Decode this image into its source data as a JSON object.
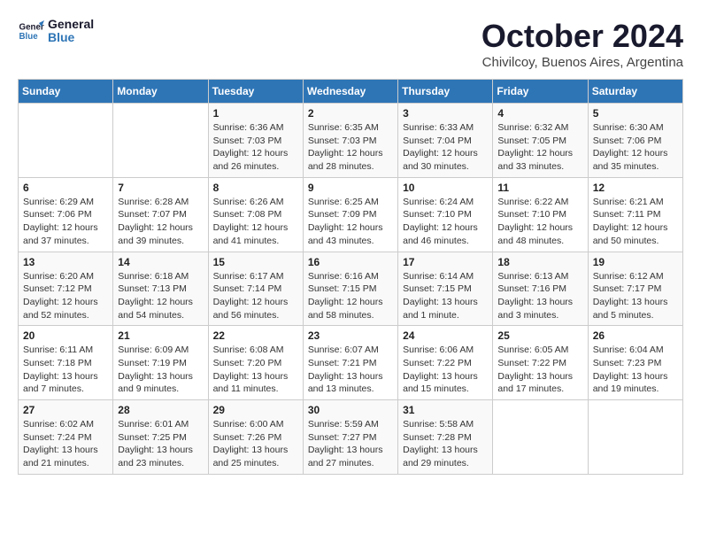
{
  "header": {
    "logo_line1": "General",
    "logo_line2": "Blue",
    "month": "October 2024",
    "location": "Chivilcoy, Buenos Aires, Argentina"
  },
  "weekdays": [
    "Sunday",
    "Monday",
    "Tuesday",
    "Wednesday",
    "Thursday",
    "Friday",
    "Saturday"
  ],
  "weeks": [
    [
      {
        "day": "",
        "info": ""
      },
      {
        "day": "",
        "info": ""
      },
      {
        "day": "1",
        "info": "Sunrise: 6:36 AM\nSunset: 7:03 PM\nDaylight: 12 hours\nand 26 minutes."
      },
      {
        "day": "2",
        "info": "Sunrise: 6:35 AM\nSunset: 7:03 PM\nDaylight: 12 hours\nand 28 minutes."
      },
      {
        "day": "3",
        "info": "Sunrise: 6:33 AM\nSunset: 7:04 PM\nDaylight: 12 hours\nand 30 minutes."
      },
      {
        "day": "4",
        "info": "Sunrise: 6:32 AM\nSunset: 7:05 PM\nDaylight: 12 hours\nand 33 minutes."
      },
      {
        "day": "5",
        "info": "Sunrise: 6:30 AM\nSunset: 7:06 PM\nDaylight: 12 hours\nand 35 minutes."
      }
    ],
    [
      {
        "day": "6",
        "info": "Sunrise: 6:29 AM\nSunset: 7:06 PM\nDaylight: 12 hours\nand 37 minutes."
      },
      {
        "day": "7",
        "info": "Sunrise: 6:28 AM\nSunset: 7:07 PM\nDaylight: 12 hours\nand 39 minutes."
      },
      {
        "day": "8",
        "info": "Sunrise: 6:26 AM\nSunset: 7:08 PM\nDaylight: 12 hours\nand 41 minutes."
      },
      {
        "day": "9",
        "info": "Sunrise: 6:25 AM\nSunset: 7:09 PM\nDaylight: 12 hours\nand 43 minutes."
      },
      {
        "day": "10",
        "info": "Sunrise: 6:24 AM\nSunset: 7:10 PM\nDaylight: 12 hours\nand 46 minutes."
      },
      {
        "day": "11",
        "info": "Sunrise: 6:22 AM\nSunset: 7:10 PM\nDaylight: 12 hours\nand 48 minutes."
      },
      {
        "day": "12",
        "info": "Sunrise: 6:21 AM\nSunset: 7:11 PM\nDaylight: 12 hours\nand 50 minutes."
      }
    ],
    [
      {
        "day": "13",
        "info": "Sunrise: 6:20 AM\nSunset: 7:12 PM\nDaylight: 12 hours\nand 52 minutes."
      },
      {
        "day": "14",
        "info": "Sunrise: 6:18 AM\nSunset: 7:13 PM\nDaylight: 12 hours\nand 54 minutes."
      },
      {
        "day": "15",
        "info": "Sunrise: 6:17 AM\nSunset: 7:14 PM\nDaylight: 12 hours\nand 56 minutes."
      },
      {
        "day": "16",
        "info": "Sunrise: 6:16 AM\nSunset: 7:15 PM\nDaylight: 12 hours\nand 58 minutes."
      },
      {
        "day": "17",
        "info": "Sunrise: 6:14 AM\nSunset: 7:15 PM\nDaylight: 13 hours\nand 1 minute."
      },
      {
        "day": "18",
        "info": "Sunrise: 6:13 AM\nSunset: 7:16 PM\nDaylight: 13 hours\nand 3 minutes."
      },
      {
        "day": "19",
        "info": "Sunrise: 6:12 AM\nSunset: 7:17 PM\nDaylight: 13 hours\nand 5 minutes."
      }
    ],
    [
      {
        "day": "20",
        "info": "Sunrise: 6:11 AM\nSunset: 7:18 PM\nDaylight: 13 hours\nand 7 minutes."
      },
      {
        "day": "21",
        "info": "Sunrise: 6:09 AM\nSunset: 7:19 PM\nDaylight: 13 hours\nand 9 minutes."
      },
      {
        "day": "22",
        "info": "Sunrise: 6:08 AM\nSunset: 7:20 PM\nDaylight: 13 hours\nand 11 minutes."
      },
      {
        "day": "23",
        "info": "Sunrise: 6:07 AM\nSunset: 7:21 PM\nDaylight: 13 hours\nand 13 minutes."
      },
      {
        "day": "24",
        "info": "Sunrise: 6:06 AM\nSunset: 7:22 PM\nDaylight: 13 hours\nand 15 minutes."
      },
      {
        "day": "25",
        "info": "Sunrise: 6:05 AM\nSunset: 7:22 PM\nDaylight: 13 hours\nand 17 minutes."
      },
      {
        "day": "26",
        "info": "Sunrise: 6:04 AM\nSunset: 7:23 PM\nDaylight: 13 hours\nand 19 minutes."
      }
    ],
    [
      {
        "day": "27",
        "info": "Sunrise: 6:02 AM\nSunset: 7:24 PM\nDaylight: 13 hours\nand 21 minutes."
      },
      {
        "day": "28",
        "info": "Sunrise: 6:01 AM\nSunset: 7:25 PM\nDaylight: 13 hours\nand 23 minutes."
      },
      {
        "day": "29",
        "info": "Sunrise: 6:00 AM\nSunset: 7:26 PM\nDaylight: 13 hours\nand 25 minutes."
      },
      {
        "day": "30",
        "info": "Sunrise: 5:59 AM\nSunset: 7:27 PM\nDaylight: 13 hours\nand 27 minutes."
      },
      {
        "day": "31",
        "info": "Sunrise: 5:58 AM\nSunset: 7:28 PM\nDaylight: 13 hours\nand 29 minutes."
      },
      {
        "day": "",
        "info": ""
      },
      {
        "day": "",
        "info": ""
      }
    ]
  ]
}
